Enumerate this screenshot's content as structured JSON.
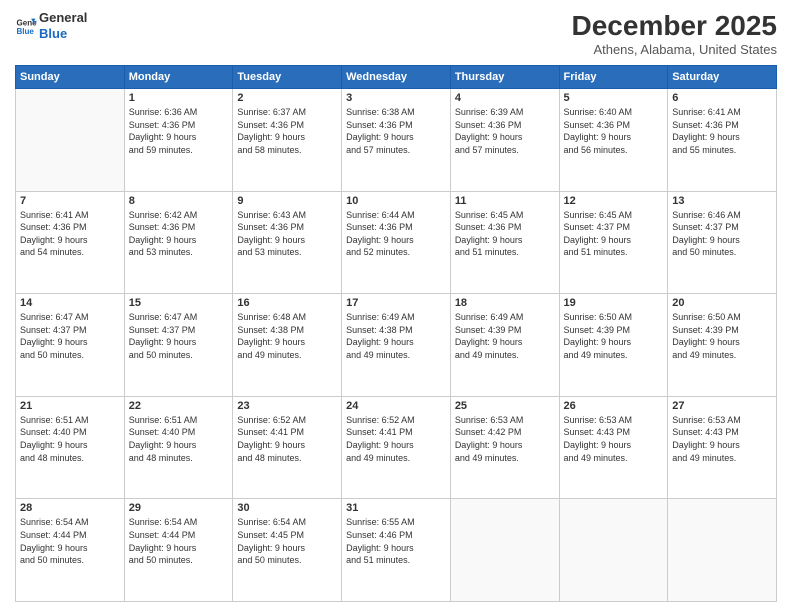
{
  "logo": {
    "line1": "General",
    "line2": "Blue"
  },
  "title": "December 2025",
  "subtitle": "Athens, Alabama, United States",
  "header": {
    "days": [
      "Sunday",
      "Monday",
      "Tuesday",
      "Wednesday",
      "Thursday",
      "Friday",
      "Saturday"
    ]
  },
  "weeks": [
    [
      {
        "num": "",
        "info": ""
      },
      {
        "num": "1",
        "info": "Sunrise: 6:36 AM\nSunset: 4:36 PM\nDaylight: 9 hours\nand 59 minutes."
      },
      {
        "num": "2",
        "info": "Sunrise: 6:37 AM\nSunset: 4:36 PM\nDaylight: 9 hours\nand 58 minutes."
      },
      {
        "num": "3",
        "info": "Sunrise: 6:38 AM\nSunset: 4:36 PM\nDaylight: 9 hours\nand 57 minutes."
      },
      {
        "num": "4",
        "info": "Sunrise: 6:39 AM\nSunset: 4:36 PM\nDaylight: 9 hours\nand 57 minutes."
      },
      {
        "num": "5",
        "info": "Sunrise: 6:40 AM\nSunset: 4:36 PM\nDaylight: 9 hours\nand 56 minutes."
      },
      {
        "num": "6",
        "info": "Sunrise: 6:41 AM\nSunset: 4:36 PM\nDaylight: 9 hours\nand 55 minutes."
      }
    ],
    [
      {
        "num": "7",
        "info": "Sunrise: 6:41 AM\nSunset: 4:36 PM\nDaylight: 9 hours\nand 54 minutes."
      },
      {
        "num": "8",
        "info": "Sunrise: 6:42 AM\nSunset: 4:36 PM\nDaylight: 9 hours\nand 53 minutes."
      },
      {
        "num": "9",
        "info": "Sunrise: 6:43 AM\nSunset: 4:36 PM\nDaylight: 9 hours\nand 53 minutes."
      },
      {
        "num": "10",
        "info": "Sunrise: 6:44 AM\nSunset: 4:36 PM\nDaylight: 9 hours\nand 52 minutes."
      },
      {
        "num": "11",
        "info": "Sunrise: 6:45 AM\nSunset: 4:36 PM\nDaylight: 9 hours\nand 51 minutes."
      },
      {
        "num": "12",
        "info": "Sunrise: 6:45 AM\nSunset: 4:37 PM\nDaylight: 9 hours\nand 51 minutes."
      },
      {
        "num": "13",
        "info": "Sunrise: 6:46 AM\nSunset: 4:37 PM\nDaylight: 9 hours\nand 50 minutes."
      }
    ],
    [
      {
        "num": "14",
        "info": "Sunrise: 6:47 AM\nSunset: 4:37 PM\nDaylight: 9 hours\nand 50 minutes."
      },
      {
        "num": "15",
        "info": "Sunrise: 6:47 AM\nSunset: 4:37 PM\nDaylight: 9 hours\nand 50 minutes."
      },
      {
        "num": "16",
        "info": "Sunrise: 6:48 AM\nSunset: 4:38 PM\nDaylight: 9 hours\nand 49 minutes."
      },
      {
        "num": "17",
        "info": "Sunrise: 6:49 AM\nSunset: 4:38 PM\nDaylight: 9 hours\nand 49 minutes."
      },
      {
        "num": "18",
        "info": "Sunrise: 6:49 AM\nSunset: 4:39 PM\nDaylight: 9 hours\nand 49 minutes."
      },
      {
        "num": "19",
        "info": "Sunrise: 6:50 AM\nSunset: 4:39 PM\nDaylight: 9 hours\nand 49 minutes."
      },
      {
        "num": "20",
        "info": "Sunrise: 6:50 AM\nSunset: 4:39 PM\nDaylight: 9 hours\nand 49 minutes."
      }
    ],
    [
      {
        "num": "21",
        "info": "Sunrise: 6:51 AM\nSunset: 4:40 PM\nDaylight: 9 hours\nand 48 minutes."
      },
      {
        "num": "22",
        "info": "Sunrise: 6:51 AM\nSunset: 4:40 PM\nDaylight: 9 hours\nand 48 minutes."
      },
      {
        "num": "23",
        "info": "Sunrise: 6:52 AM\nSunset: 4:41 PM\nDaylight: 9 hours\nand 48 minutes."
      },
      {
        "num": "24",
        "info": "Sunrise: 6:52 AM\nSunset: 4:41 PM\nDaylight: 9 hours\nand 49 minutes."
      },
      {
        "num": "25",
        "info": "Sunrise: 6:53 AM\nSunset: 4:42 PM\nDaylight: 9 hours\nand 49 minutes."
      },
      {
        "num": "26",
        "info": "Sunrise: 6:53 AM\nSunset: 4:43 PM\nDaylight: 9 hours\nand 49 minutes."
      },
      {
        "num": "27",
        "info": "Sunrise: 6:53 AM\nSunset: 4:43 PM\nDaylight: 9 hours\nand 49 minutes."
      }
    ],
    [
      {
        "num": "28",
        "info": "Sunrise: 6:54 AM\nSunset: 4:44 PM\nDaylight: 9 hours\nand 50 minutes."
      },
      {
        "num": "29",
        "info": "Sunrise: 6:54 AM\nSunset: 4:44 PM\nDaylight: 9 hours\nand 50 minutes."
      },
      {
        "num": "30",
        "info": "Sunrise: 6:54 AM\nSunset: 4:45 PM\nDaylight: 9 hours\nand 50 minutes."
      },
      {
        "num": "31",
        "info": "Sunrise: 6:55 AM\nSunset: 4:46 PM\nDaylight: 9 hours\nand 51 minutes."
      },
      {
        "num": "",
        "info": ""
      },
      {
        "num": "",
        "info": ""
      },
      {
        "num": "",
        "info": ""
      }
    ]
  ]
}
